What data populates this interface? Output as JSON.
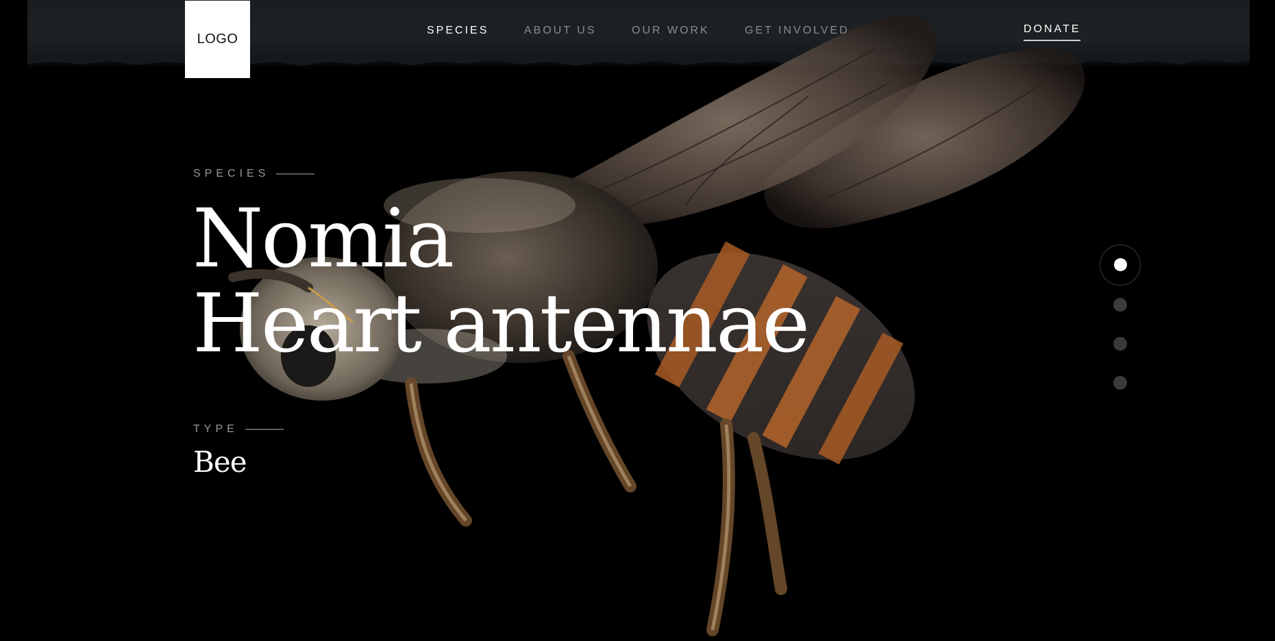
{
  "brand": {
    "logo_text": "LOGO"
  },
  "nav": {
    "items": [
      {
        "label": "SPECIES",
        "active": true
      },
      {
        "label": "ABOUT US",
        "active": false
      },
      {
        "label": "OUR WORK",
        "active": false
      },
      {
        "label": "GET INVOLVED",
        "active": false
      }
    ],
    "donate_label": "DONATE"
  },
  "hero": {
    "species_label": "SPECIES",
    "title_line1": "Nomia",
    "title_line2": "Heart antennae",
    "type_label": "TYPE",
    "type_value": "Bee",
    "image_icon": "bee-photo"
  },
  "pager": {
    "count": 4,
    "active_index": 0
  },
  "colors": {
    "background": "#000000",
    "header": "#1e2123",
    "nav_inactive": "#8a8c8d",
    "dot_inactive": "#3a3a3a",
    "accent": "#ffffff"
  }
}
